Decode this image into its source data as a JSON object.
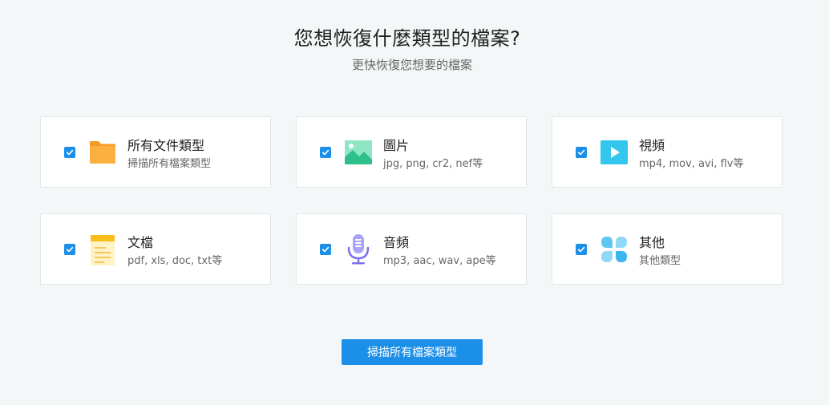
{
  "header": {
    "title": "您想恢復什麼類型的檔案?",
    "subtitle": "更快恢復您想要的檔案"
  },
  "file_types": [
    {
      "label": "所有文件類型",
      "desc": "掃描所有檔案類型",
      "checked": true,
      "icon": "folder-icon",
      "color": "#fba23a"
    },
    {
      "label": "圖片",
      "desc": "jpg, png, cr2, nef等",
      "checked": true,
      "icon": "image-icon",
      "color": "#3fcf9a"
    },
    {
      "label": "視頻",
      "desc": "mp4, mov, avi, flv等",
      "checked": true,
      "icon": "video-icon",
      "color": "#34c6ee"
    },
    {
      "label": "文檔",
      "desc": "pdf, xls, doc, txt等",
      "checked": true,
      "icon": "document-icon",
      "color": "#fbc531"
    },
    {
      "label": "音頻",
      "desc": "mp3, aac, wav, ape等",
      "checked": true,
      "icon": "microphone-icon",
      "color": "#8a7ff3"
    },
    {
      "label": "其他",
      "desc": "其他類型",
      "checked": true,
      "icon": "other-icon",
      "color": "#3cb6ee"
    }
  ],
  "scan_button": {
    "label": "掃描所有檔案類型"
  },
  "colors": {
    "accent": "#1c8fe8",
    "background": "#f3f7f8"
  }
}
